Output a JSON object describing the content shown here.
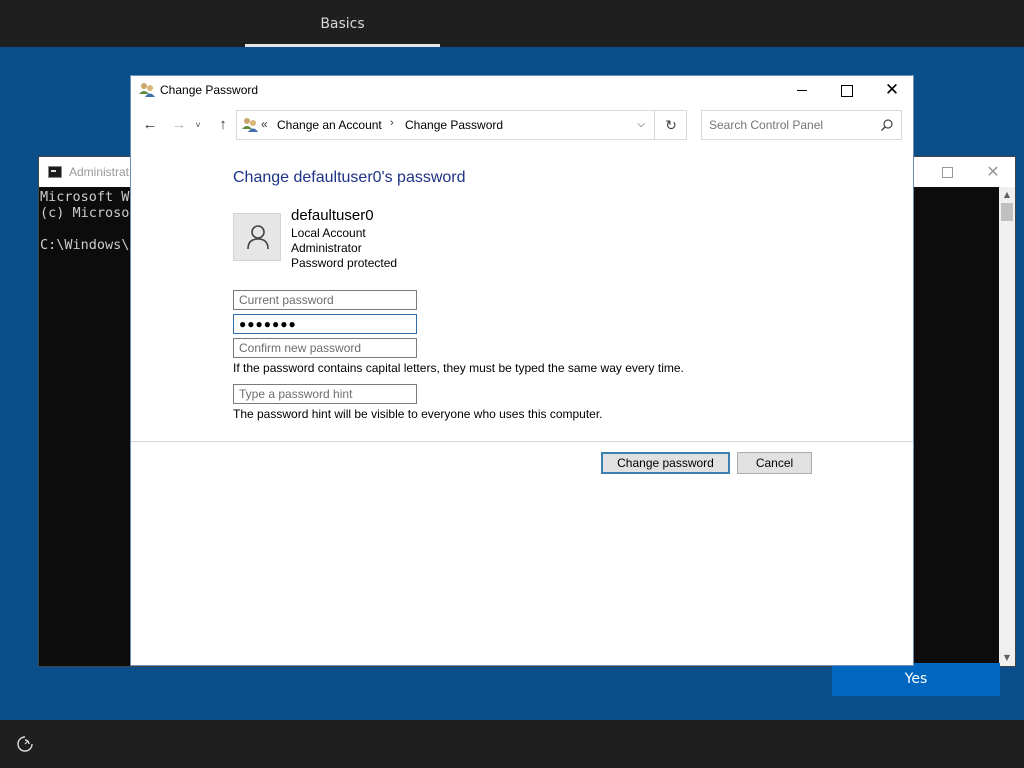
{
  "oobe": {
    "tab_label": "Basics",
    "yes_label": "Yes"
  },
  "console": {
    "title": "Administrat",
    "lines": "Microsoft Wi\n(c) Microso\n\nC:\\Windows\\s"
  },
  "window": {
    "title": "Change Password",
    "close_glyph": "✕"
  },
  "nav": {
    "back": "←",
    "forward": "→",
    "recent": "˅",
    "up": "↑",
    "crumb_sep": "«",
    "crumb_arrow": "›",
    "dropdown": "⌵",
    "refresh": "↻"
  },
  "breadcrumb": [
    "Change an Account",
    "Change Password"
  ],
  "search": {
    "placeholder": "Search Control Panel"
  },
  "page": {
    "heading": "Change defaultuser0's password"
  },
  "user": {
    "name": "defaultuser0",
    "type": "Local Account",
    "role": "Administrator",
    "status": "Password protected"
  },
  "form": {
    "current_placeholder": "Current password",
    "new_value": "●●●●●●●",
    "confirm_placeholder": "Confirm new password",
    "caps_note": "If the password contains capital letters, they must be typed the same way every time.",
    "hint_placeholder": "Type a password hint",
    "hint_note": "The password hint will be visible to everyone who uses this computer."
  },
  "buttons": {
    "change_password": "Change password",
    "cancel": "Cancel"
  },
  "colors": {
    "desktop": "#0a4f8a",
    "heading": "#1e3287",
    "accent": "#0067c0"
  }
}
